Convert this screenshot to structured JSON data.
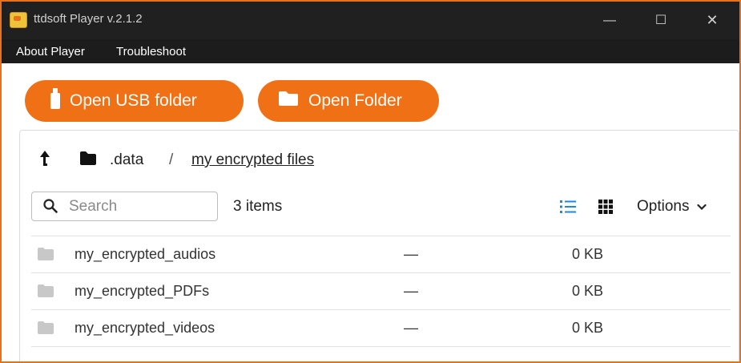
{
  "window": {
    "title": "ttdsoft Player v.2.1.2",
    "controls": {
      "minimize": "—",
      "maximize": "☐",
      "close": "✕"
    }
  },
  "menu": {
    "items": [
      {
        "label": "About Player"
      },
      {
        "label": "Troubleshoot"
      }
    ]
  },
  "toolbar": {
    "open_usb_label": "Open USB folder",
    "open_folder_label": "Open Folder",
    "accent_color": "#f07016"
  },
  "breadcrumb": {
    "up_icon": "arrow-up-icon",
    "folder_icon": "folder-icon",
    "parent": ".data",
    "separator": "/",
    "current": "my encrypted files"
  },
  "search": {
    "placeholder": "Search",
    "value": ""
  },
  "item_count": "3 items",
  "view": {
    "list_icon": "list-view-icon",
    "grid_icon": "grid-view-icon",
    "active": "list",
    "options_label": "Options",
    "options_icon": "chevron-down-icon",
    "active_color": "#1e88e5"
  },
  "files": [
    {
      "name": "my_encrypted_audios",
      "modified": "—",
      "size": "0 KB"
    },
    {
      "name": "my_encrypted_PDFs",
      "modified": "—",
      "size": "0 KB"
    },
    {
      "name": "my_encrypted_videos",
      "modified": "—",
      "size": "0 KB"
    }
  ]
}
